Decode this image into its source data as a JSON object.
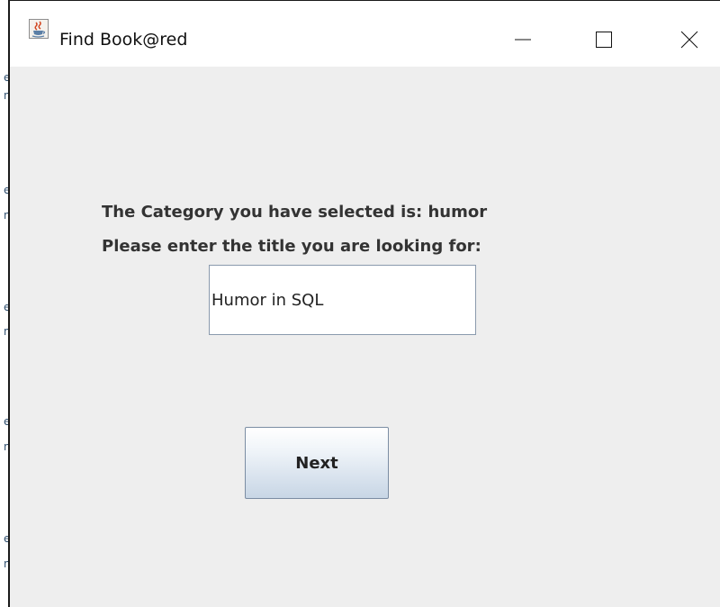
{
  "window": {
    "title": "Find Book@red",
    "controls": {
      "minimize": "minimize",
      "maximize": "maximize",
      "close": "close"
    }
  },
  "form": {
    "category_text": "The Category you have selected is: humor",
    "prompt_text": "Please enter the title you are looking for:",
    "title_value": "Humor in SQL",
    "next_label": "Next"
  },
  "icons": {
    "app": "java-coffee-icon",
    "minimize": "minimize-icon",
    "maximize": "maximize-icon",
    "close": "close-icon"
  },
  "colors": {
    "content_background": "#eeeeee",
    "titlebar_background": "#ffffff",
    "label_text": "#333333",
    "button_gradient_top": "#ffffff",
    "button_gradient_bottom": "#c8d6e5"
  }
}
